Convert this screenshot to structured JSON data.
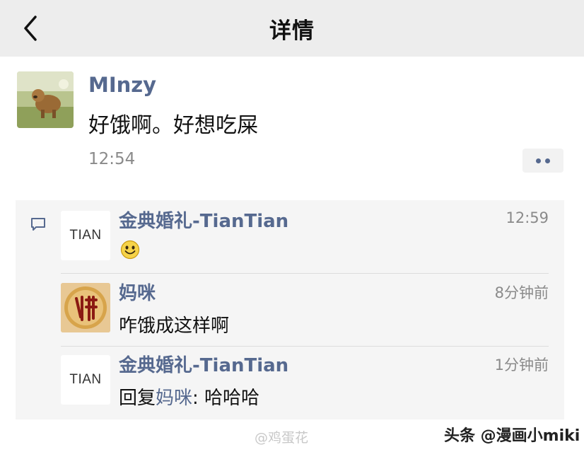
{
  "header": {
    "title": "详情"
  },
  "post": {
    "author": "MInzy",
    "text": "好饿啊。好想吃屎",
    "time": "12:54"
  },
  "comments": [
    {
      "name": "金典婚礼-TianTian",
      "avatar_text": "TIAN",
      "time": "12:59",
      "content_emoji": "smile-emoji"
    },
    {
      "name": "妈咪",
      "avatar_icon": "fo-character-avatar",
      "time": "8分钟前",
      "text": "咋饿成这样啊"
    },
    {
      "name": "金典婚礼-TianTian",
      "avatar_text": "TIAN",
      "time": "1分钟前",
      "reply_prefix": "回复",
      "reply_to": "妈咪",
      "reply_text": ": 哈哈哈"
    }
  ],
  "watermarks": {
    "left": "@鸡蛋花",
    "right": "头条 @漫画小miki"
  },
  "colors": {
    "link": "#56698f",
    "topbar": "#ededed",
    "panel": "#f5f5f5"
  }
}
